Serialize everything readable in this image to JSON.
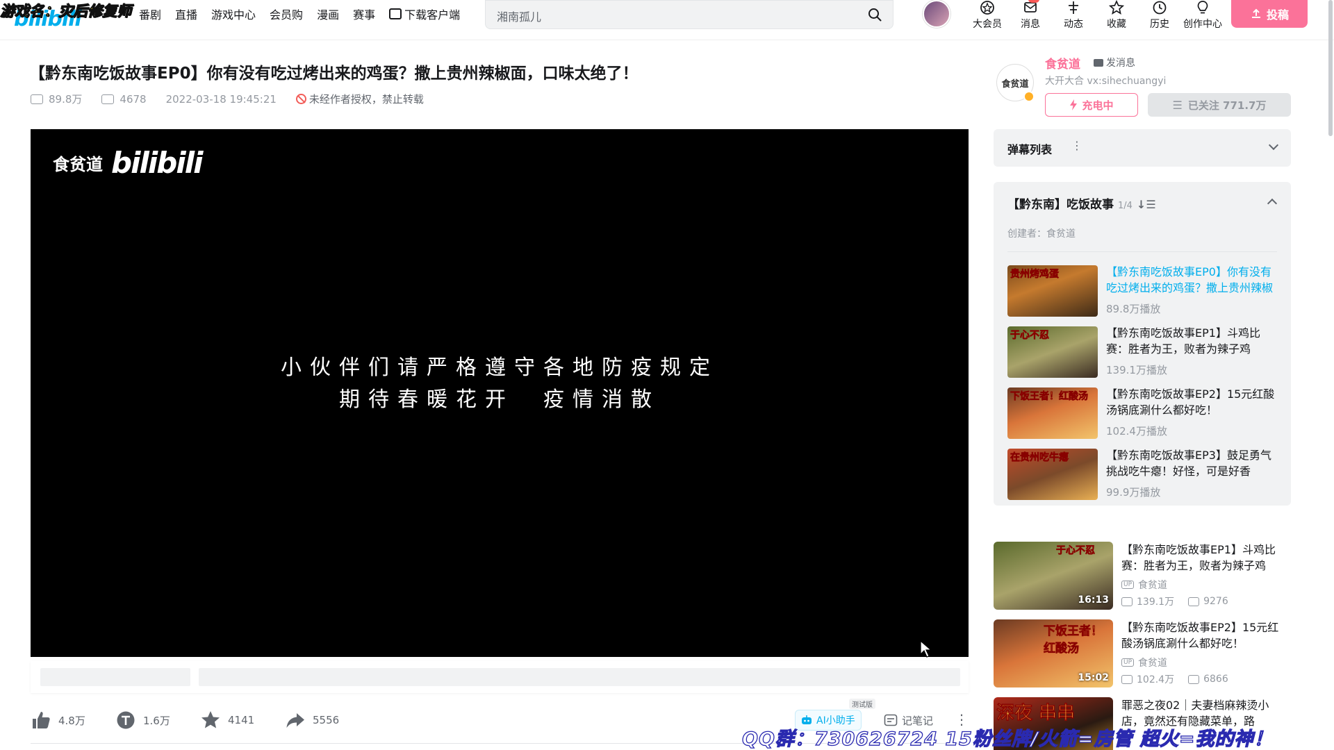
{
  "overlay": {
    "game_name": "游戏名：灾后修复师",
    "qq_group": "QQ群：730626724  15粉丝牌/火箭=房管 超火=我的神！"
  },
  "header": {
    "logo": "bilibili",
    "nav": [
      "番剧",
      "直播",
      "游戏中心",
      "会员购",
      "漫画",
      "赛事",
      "下载客户端"
    ],
    "search_placeholder": "湘南孤儿",
    "right_icons": [
      "大会员",
      "消息",
      "动态",
      "收藏",
      "历史",
      "创作中心"
    ],
    "upload_label": "投稿"
  },
  "video": {
    "title": "【黔东南吃饭故事EP0】你有没有吃过烤出来的鸡蛋？撒上贵州辣椒面，口味太绝了！",
    "views": "89.8万",
    "danmaku_count": "4678",
    "publish_time": "2022-03-18 19:45:21",
    "copyright_note": "未经作者授权，禁止转载",
    "watermark_cn": "食贫道",
    "watermark_logo": "bilibili",
    "subtitle_line1": "小伙伴们请严格遵守各地防疫规定",
    "subtitle_line2": "期待春暖花开　疫情消散"
  },
  "actions": {
    "like": "4.8万",
    "coin": "1.6万",
    "favorite": "4141",
    "share": "5556",
    "ai_label": "AI小助手",
    "ai_tag": "测试版",
    "note_label": "记笔记"
  },
  "uploader": {
    "name": "食贫道",
    "message": "发消息",
    "desc": "大开大合 vx:sihechuangyi",
    "avatar_text": "食贫道",
    "charge_label": "充电中",
    "follow_label": "已关注 771.7万"
  },
  "danmaku_list": {
    "title": "弹幕列表"
  },
  "playlist": {
    "title": "【黔东南】吃饭故事",
    "count": "1/4",
    "creator": "创建者：食贫道",
    "items": [
      {
        "title": "【黔东南吃饭故事EP0】你有没有吃过烤出来的鸡蛋？撒上贵州辣椒面",
        "views": "89.8万播放",
        "thumb_label": "贵州烤鸡蛋"
      },
      {
        "title": "【黔东南吃饭故事EP1】斗鸡比赛：胜者为王，败者为辣子鸡",
        "views": "139.1万播放",
        "thumb_label": "于心不忍"
      },
      {
        "title": "【黔东南吃饭故事EP2】15元红酸汤锅底涮什么都好吃！",
        "views": "102.4万播放",
        "thumb_label": "下饭王者！红酸汤"
      },
      {
        "title": "【黔东南吃饭故事EP3】鼓足勇气挑战吃牛瘪！好怪，可是好香",
        "views": "99.9万播放",
        "thumb_label": "在贵州吃牛瘪"
      }
    ]
  },
  "recommendations": [
    {
      "title": "【黔东南吃饭故事EP1】斗鸡比赛：胜者为王，败者为辣子鸡",
      "up": "食贫道",
      "views": "139.1万",
      "danmaku": "9276",
      "duration": "16:13",
      "thumb_label": "于心不忍"
    },
    {
      "title": "【黔东南吃饭故事EP2】15元红酸汤锅底涮什么都好吃！",
      "up": "食贫道",
      "views": "102.4万",
      "danmaku": "6866",
      "duration": "15:02",
      "thumb_label": "下饭王者！红酸汤"
    },
    {
      "title": "罪恶之夜02｜夫妻档麻辣烫小店，竟然还有隐藏菜单，路",
      "up": "",
      "views": "",
      "danmaku": "",
      "duration": "",
      "thumb_label": "深夜 串串"
    }
  ],
  "colors": {
    "brand_blue": "#00aeec",
    "brand_pink": "#fb7299",
    "panel_bg": "#f1f2f3"
  }
}
